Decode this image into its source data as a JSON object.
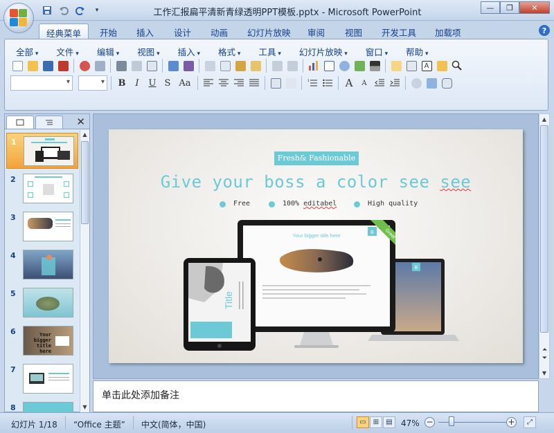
{
  "window": {
    "title": "工作汇报扁平清新青绿透明PPT模板.pptx - Microsoft PowerPoint",
    "minimize_icon": "minimize-icon",
    "maximize_icon": "restore-icon",
    "close_icon": "close-icon"
  },
  "ribbon": {
    "tabs": [
      {
        "label": "经典菜单",
        "active": true
      },
      {
        "label": "开始"
      },
      {
        "label": "插入"
      },
      {
        "label": "设计"
      },
      {
        "label": "动画"
      },
      {
        "label": "幻灯片放映"
      },
      {
        "label": "审阅"
      },
      {
        "label": "视图"
      },
      {
        "label": "开发工具"
      },
      {
        "label": "加载项"
      }
    ],
    "help_label": "?"
  },
  "menubar": {
    "items": [
      "全部",
      "文件",
      "编辑",
      "视图",
      "插入",
      "格式",
      "工具",
      "幻灯片放映",
      "窗口",
      "帮助"
    ]
  },
  "format": {
    "bold": "B",
    "italic": "I",
    "underline": "U",
    "shadow": "S",
    "case": "Aa",
    "font_grow": "A",
    "font_shrink": "A"
  },
  "panel": {
    "close_label": "✕",
    "slide_numbers": [
      "1",
      "2",
      "3",
      "4",
      "5",
      "6",
      "7",
      "8"
    ],
    "thumb6_text": "Your bigger title here"
  },
  "slide": {
    "badge": "Fresh& Fashionable",
    "title_main": "Give your boss a color see ",
    "title_tail": "see",
    "features": [
      "Free",
      "100% editabel",
      "High quality"
    ],
    "screen_title": "Your bigger title here",
    "tablet_title": "Title",
    "corner_ribbon": "Great",
    "monitor_badge": "B",
    "laptop_badge": "B"
  },
  "notes": {
    "placeholder": "单击此处添加备注"
  },
  "statusbar": {
    "slide_info": "幻灯片 1/18",
    "theme": "“Office 主题”",
    "language": "中文(简体，中国)",
    "zoom": "47%"
  },
  "colors": {
    "accent": "#6ccad6",
    "selected_thumb": "#f3a33a"
  }
}
